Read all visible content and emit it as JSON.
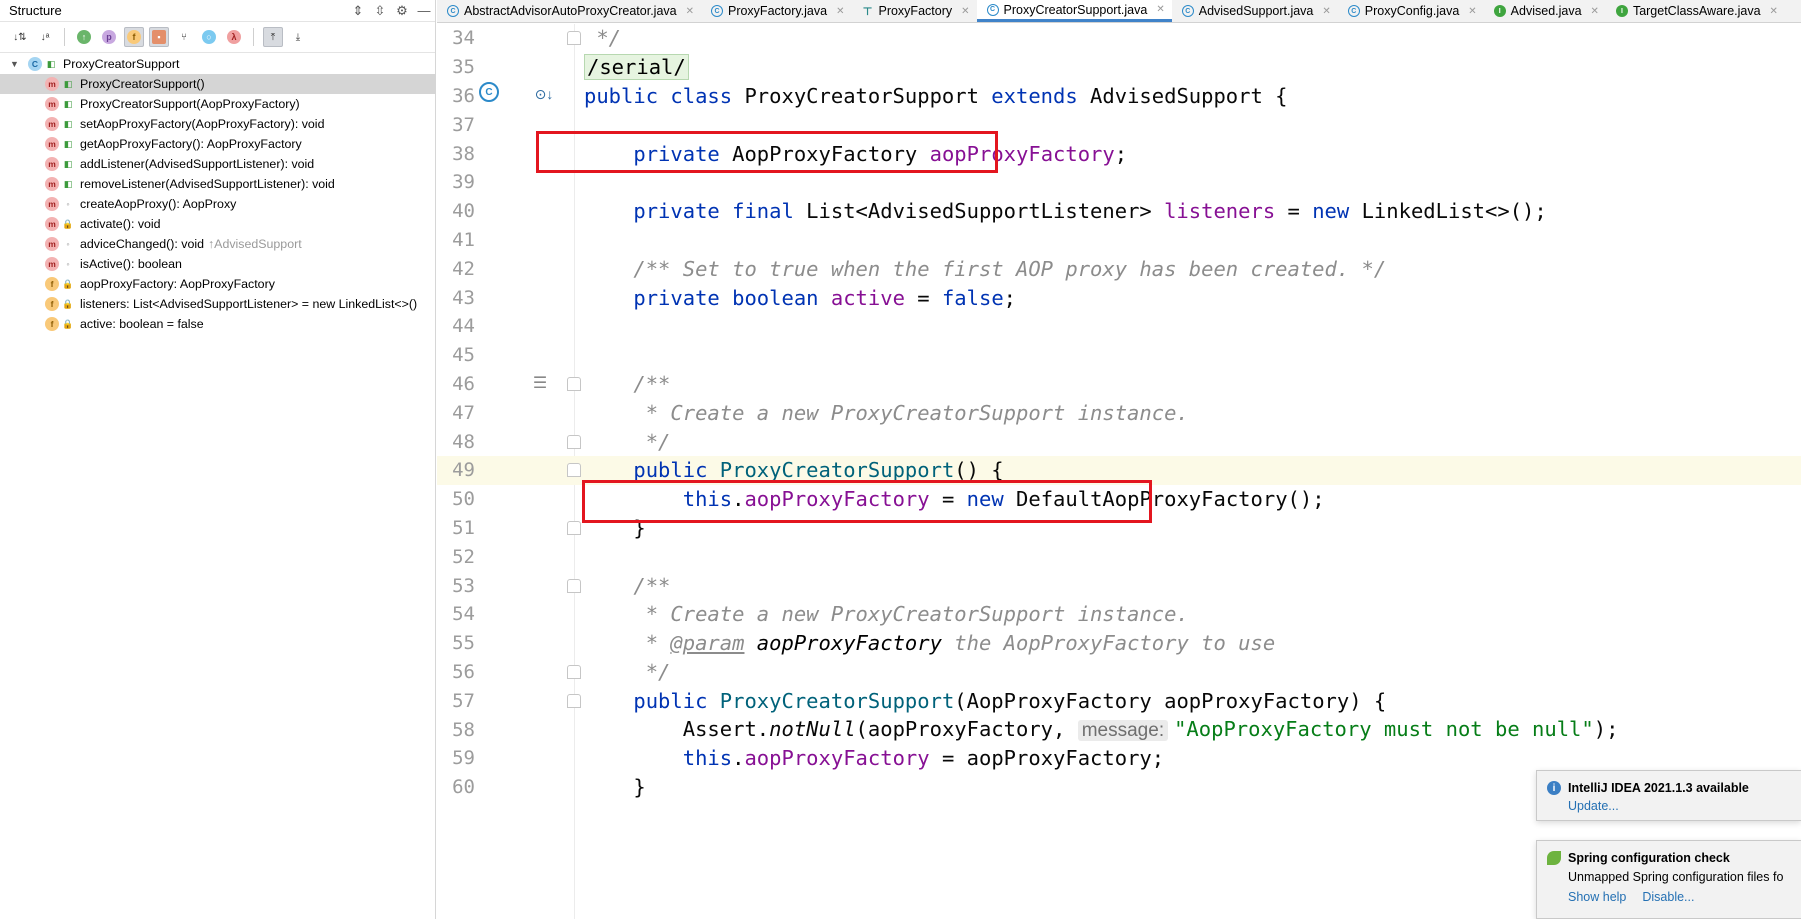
{
  "structure": {
    "title": "Structure",
    "titlebar_icons": [
      "expand-all-icon",
      "collapse-all-icon",
      "settings-icon",
      "minimize-icon"
    ],
    "toolbar_icons": [
      "sort-by-visibility-icon",
      "sort-alphabetically-icon",
      "show-inherited-icon",
      "show-properties-icon",
      "show-fields-icon",
      "show-non-public-icon",
      "show-anonymous-icon",
      "show-lambdas-icon",
      "show-lambdas2-icon",
      "autoscroll-to-source-icon",
      "autoscroll-from-source-icon"
    ],
    "root": {
      "label": "ProxyCreatorSupport",
      "kind": "class"
    },
    "items": [
      {
        "label": "ProxyCreatorSupport()",
        "kind": "m",
        "vis": "pub",
        "selected": true
      },
      {
        "label": "ProxyCreatorSupport(AopProxyFactory)",
        "kind": "m",
        "vis": "pub"
      },
      {
        "label": "setAopProxyFactory(AopProxyFactory): void",
        "kind": "m",
        "vis": "pub"
      },
      {
        "label": "getAopProxyFactory(): AopProxyFactory",
        "kind": "m",
        "vis": "pub"
      },
      {
        "label": "addListener(AdvisedSupportListener): void",
        "kind": "m",
        "vis": "pub"
      },
      {
        "label": "removeListener(AdvisedSupportListener): void",
        "kind": "m",
        "vis": "pub"
      },
      {
        "label": "createAopProxy(): AopProxy",
        "kind": "m",
        "vis": "pkg"
      },
      {
        "label": "activate(): void",
        "kind": "m",
        "vis": "priv"
      },
      {
        "label": "adviceChanged(): void",
        "kind": "m",
        "vis": "pkg",
        "inherited": "↑AdvisedSupport"
      },
      {
        "label": "isActive(): boolean",
        "kind": "m",
        "vis": "pkg"
      },
      {
        "label": "aopProxyFactory: AopProxyFactory",
        "kind": "f",
        "vis": "priv"
      },
      {
        "label": "listeners: List<AdvisedSupportListener> = new LinkedList<>()",
        "kind": "f",
        "vis": "priv"
      },
      {
        "label": "active: boolean = false",
        "kind": "f",
        "vis": "priv"
      }
    ]
  },
  "tabs": [
    {
      "label": "AbstractAdvisorAutoProxyCreator.java",
      "icon": "c"
    },
    {
      "label": "ProxyFactory.java",
      "icon": "c"
    },
    {
      "label": "ProxyFactory",
      "icon": "d"
    },
    {
      "label": "ProxyCreatorSupport.java",
      "icon": "c",
      "active": true
    },
    {
      "label": "AdvisedSupport.java",
      "icon": "c"
    },
    {
      "label": "ProxyConfig.java",
      "icon": "c"
    },
    {
      "label": "Advised.java",
      "icon": "i"
    },
    {
      "label": "TargetClassAware.java",
      "icon": "i"
    }
  ],
  "editor": {
    "lines": [
      {
        "n": "34",
        "html": "<span class=\"cmt\"> */</span>"
      },
      {
        "n": "35",
        "html": "<span class=\"serial\">/serial/</span>"
      },
      {
        "n": "36",
        "html": "<span class=\"kw\">public class</span> ProxyCreatorSupport <span class=\"kw\">extends</span> AdvisedSupport {"
      },
      {
        "n": "37",
        "html": ""
      },
      {
        "n": "38",
        "html": "    <span class=\"kw\">private</span> AopProxyFactory <span class=\"fld\">aopProxyFactory</span>;"
      },
      {
        "n": "39",
        "html": ""
      },
      {
        "n": "40",
        "html": "    <span class=\"kw\">private final</span> List&lt;AdvisedSupportListener&gt; <span class=\"fld\">listeners</span> = <span class=\"kw\">new</span> LinkedList&lt;&gt;();"
      },
      {
        "n": "41",
        "html": ""
      },
      {
        "n": "42",
        "html": "    <span class=\"cmt\">/** Set to true when the first AOP proxy has been created. */</span>"
      },
      {
        "n": "43",
        "html": "    <span class=\"kw\">private boolean</span> <span class=\"fld\">active</span> = <span class=\"kw\">false</span>;"
      },
      {
        "n": "44",
        "html": ""
      },
      {
        "n": "45",
        "html": ""
      },
      {
        "n": "46",
        "html": "    <span class=\"cmt\">/**</span>"
      },
      {
        "n": "47",
        "html": "    <span class=\"cmt\"> * Create a new ProxyCreatorSupport instance.</span>"
      },
      {
        "n": "48",
        "html": "    <span class=\"cmt\"> */</span>"
      },
      {
        "n": "49",
        "html": "    <span class=\"kw\">public</span> <span class=\"cls\">ProxyCreatorSupport</span>() {",
        "current": true
      },
      {
        "n": "50",
        "html": "        <span class=\"kw\">this</span>.<span class=\"fld\">aopProxyFactory</span> = <span class=\"kw\">new</span> DefaultAopProxyFactory();"
      },
      {
        "n": "51",
        "html": "    }"
      },
      {
        "n": "52",
        "html": ""
      },
      {
        "n": "53",
        "html": "    <span class=\"cmt\">/**</span>"
      },
      {
        "n": "54",
        "html": "    <span class=\"cmt\"> * Create a new ProxyCreatorSupport instance.</span>"
      },
      {
        "n": "55",
        "html": "    <span class=\"cmt\"> * </span><span class=\"tag\">@param</span><span class=\"cmt\" style=\"color:#000\"> aopProxyFactory</span><span class=\"cmt\"> the AopProxyFactory to use</span>"
      },
      {
        "n": "56",
        "html": "    <span class=\"cmt\"> */</span>"
      },
      {
        "n": "57",
        "html": "    <span class=\"kw\">public</span> <span class=\"cls\">ProxyCreatorSupport</span>(AopProxyFactory aopProxyFactory) {"
      },
      {
        "n": "58",
        "html": "        Assert.<span class=\"static\">notNull</span>(aopProxyFactory, <span class=\"hint\">message:</span><span class=\"str\">\"AopProxyFactory must not be null\"</span>);"
      },
      {
        "n": "59",
        "html": "        <span class=\"kw\">this</span>.<span class=\"fld\">aopProxyFactory</span> = aopProxyFactory;"
      },
      {
        "n": "60",
        "html": "    }"
      }
    ]
  },
  "notifications": [
    {
      "title": "IntelliJ IDEA 2021.1.3 available",
      "icon": "info-icon",
      "links": [
        "Update..."
      ]
    },
    {
      "title": "Spring configuration check",
      "icon": "spring-leaf-icon",
      "body": "Unmapped Spring configuration files fo",
      "links": [
        "Show help",
        "Disable..."
      ]
    }
  ],
  "colors": {
    "keyword": "#0033b3",
    "field": "#871094",
    "comment": "#8c8c8c",
    "highlight_box": "#e3161f",
    "active_tab": "#4083c9"
  }
}
